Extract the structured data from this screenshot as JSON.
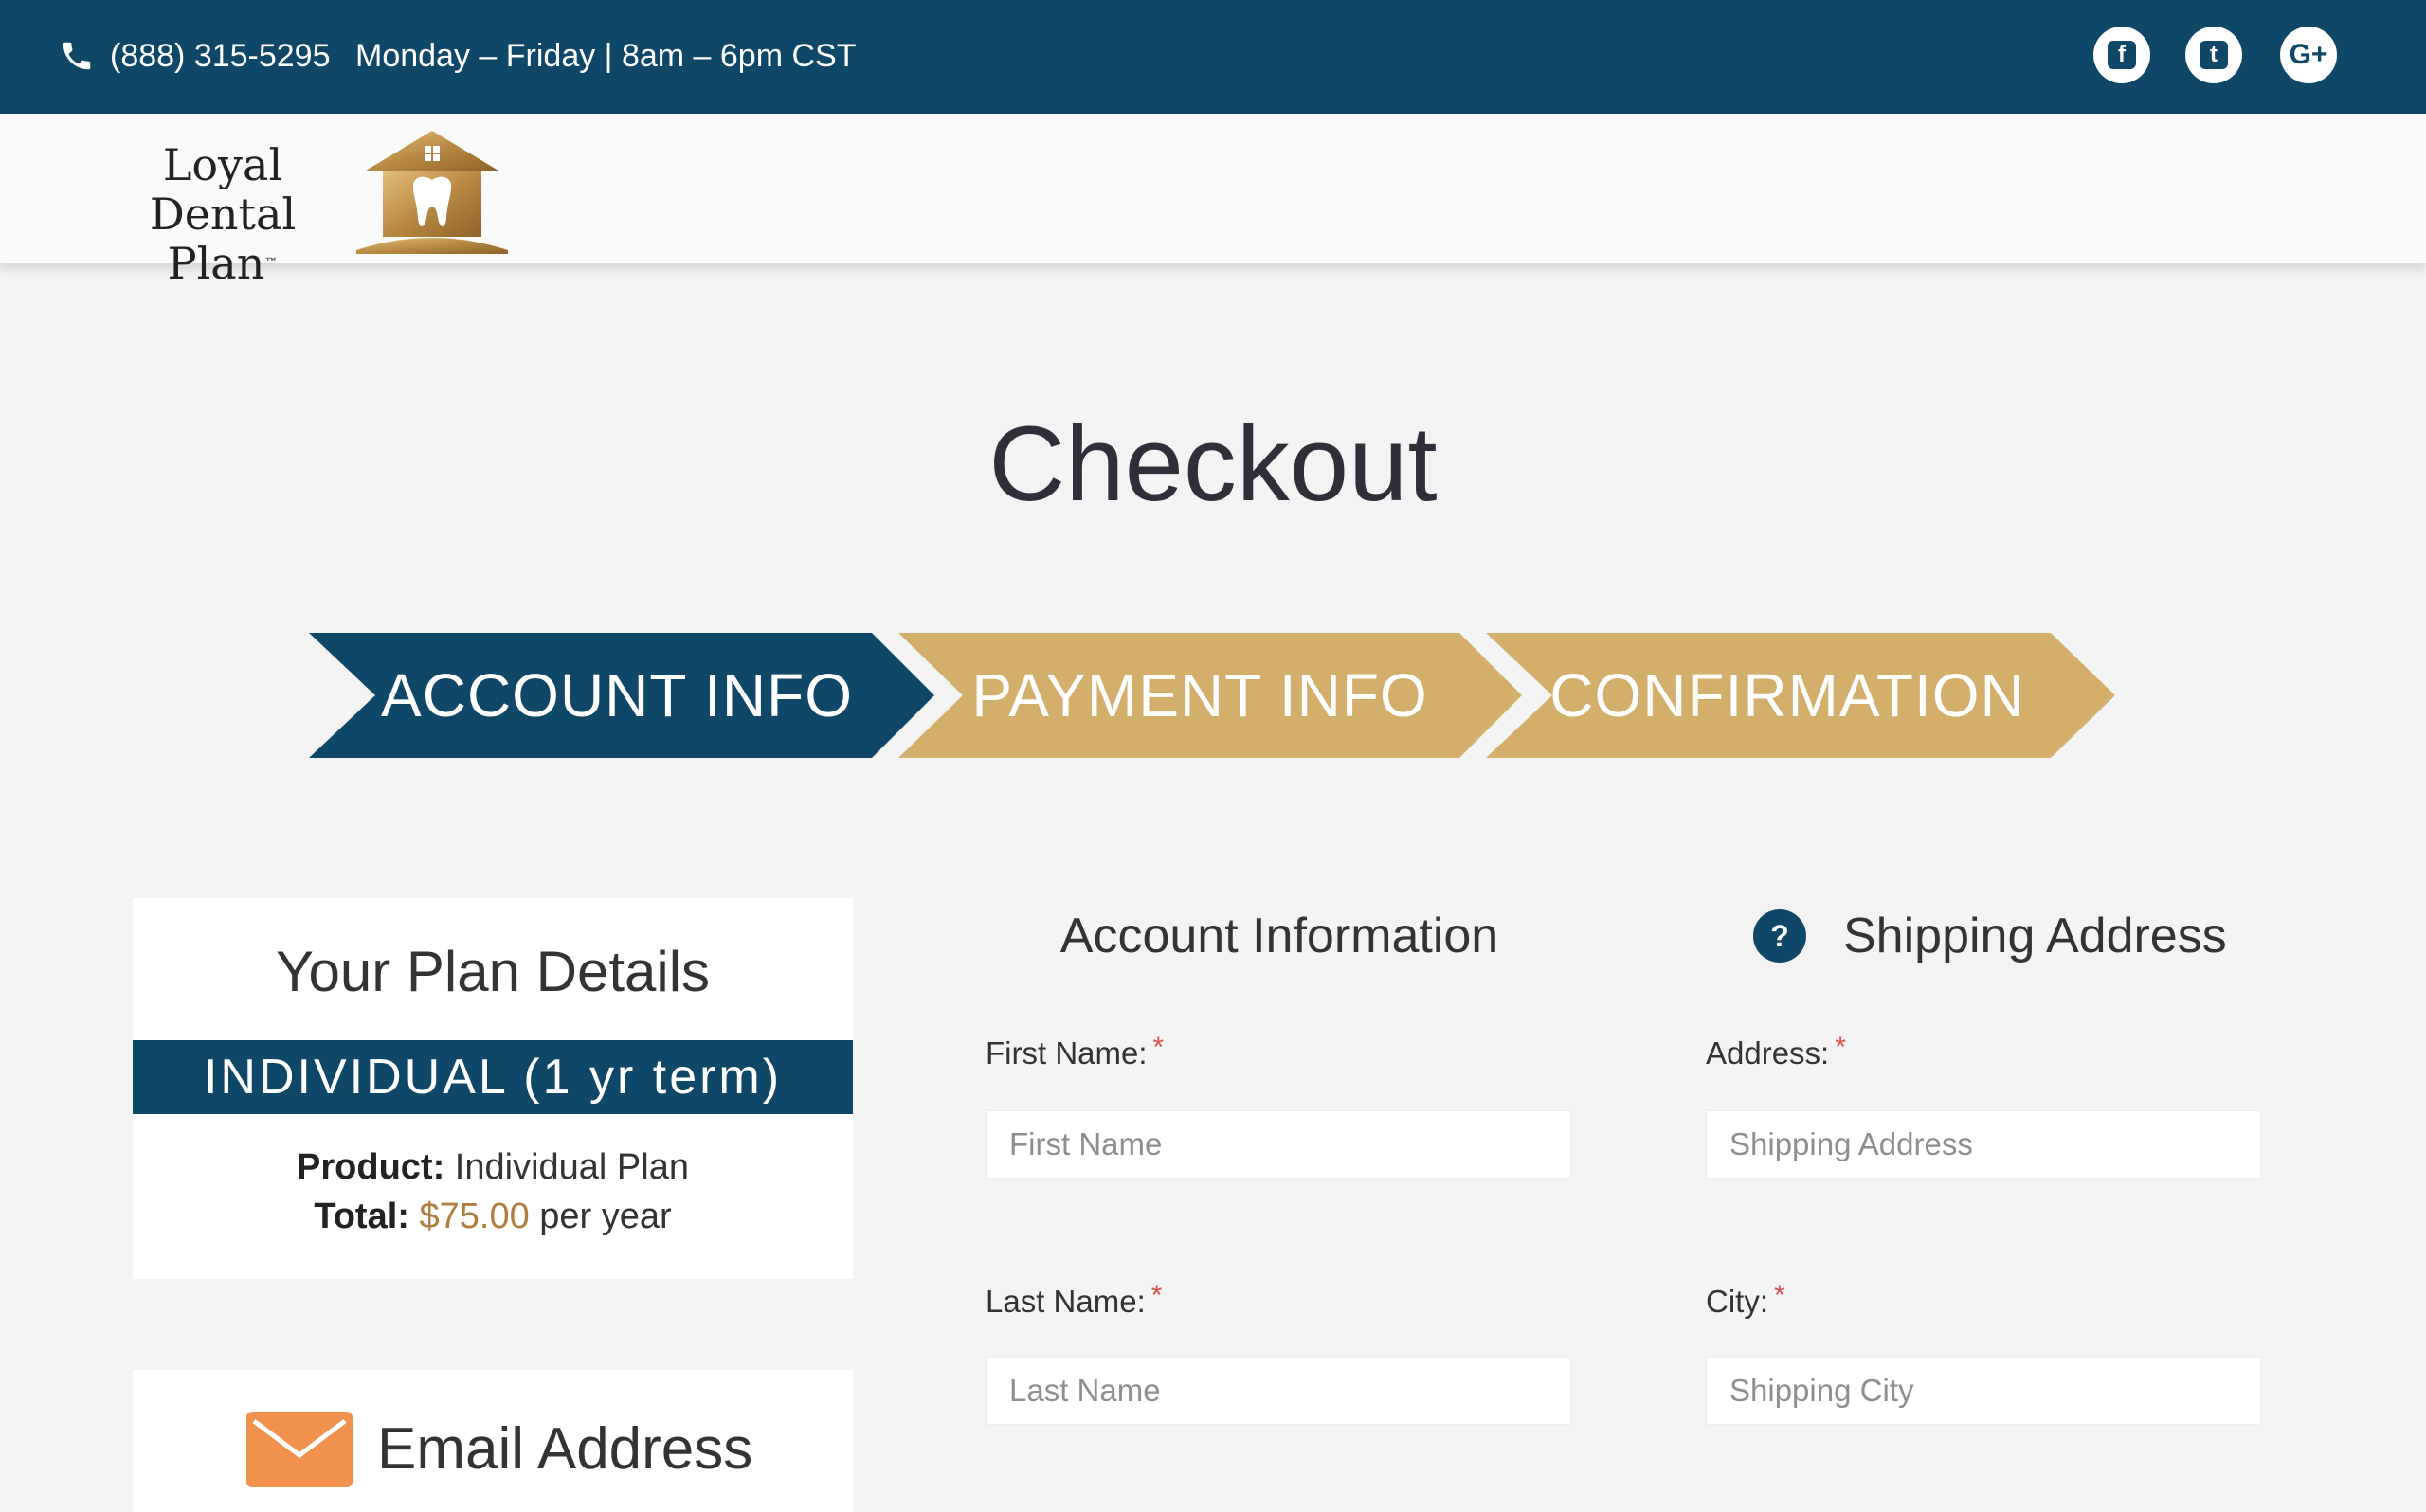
{
  "topbar": {
    "phone": "(888) 315-5295",
    "hours": "Monday – Friday | 8am – 6pm CST",
    "social": [
      {
        "name": "facebook-icon",
        "glyph": "f"
      },
      {
        "name": "twitter-icon",
        "glyph": "t"
      },
      {
        "name": "google-plus-icon",
        "glyph": "G+"
      }
    ]
  },
  "header": {
    "logo_line1": "Loyal Dental",
    "logo_line2": "Plan",
    "logo_tm": "™"
  },
  "page": {
    "title": "Checkout"
  },
  "steps": [
    {
      "label": "ACCOUNT INFO",
      "active": true,
      "color": "#0f4768"
    },
    {
      "label": "PAYMENT INFO",
      "active": false,
      "color": "#d4ae6b"
    },
    {
      "label": "CONFIRMATION",
      "active": false,
      "color": "#d4ae6b"
    }
  ],
  "plan": {
    "title": "Your Plan Details",
    "band": "INDIVIDUAL (1 yr term)",
    "product_label": "Product:",
    "product_value": "Individual Plan",
    "total_label": "Total:",
    "total_price": "$75.00",
    "total_suffix": "per year"
  },
  "email": {
    "title": "Email Address"
  },
  "account": {
    "title": "Account Information",
    "first_name_label": "First Name:",
    "first_name_placeholder": "First Name",
    "last_name_label": "Last Name:",
    "last_name_placeholder": "Last Name"
  },
  "shipping": {
    "title": "Shipping Address",
    "help": "?",
    "address_label": "Address:",
    "address_placeholder": "Shipping Address",
    "city_label": "City:",
    "city_placeholder": "Shipping City"
  },
  "required_mark": "*",
  "colors": {
    "brand_navy": "#0f4768",
    "brand_gold": "#d4ae6b",
    "price_gold": "#b07d3e",
    "required_red": "#d9534f",
    "email_orange": "#f0924e"
  }
}
